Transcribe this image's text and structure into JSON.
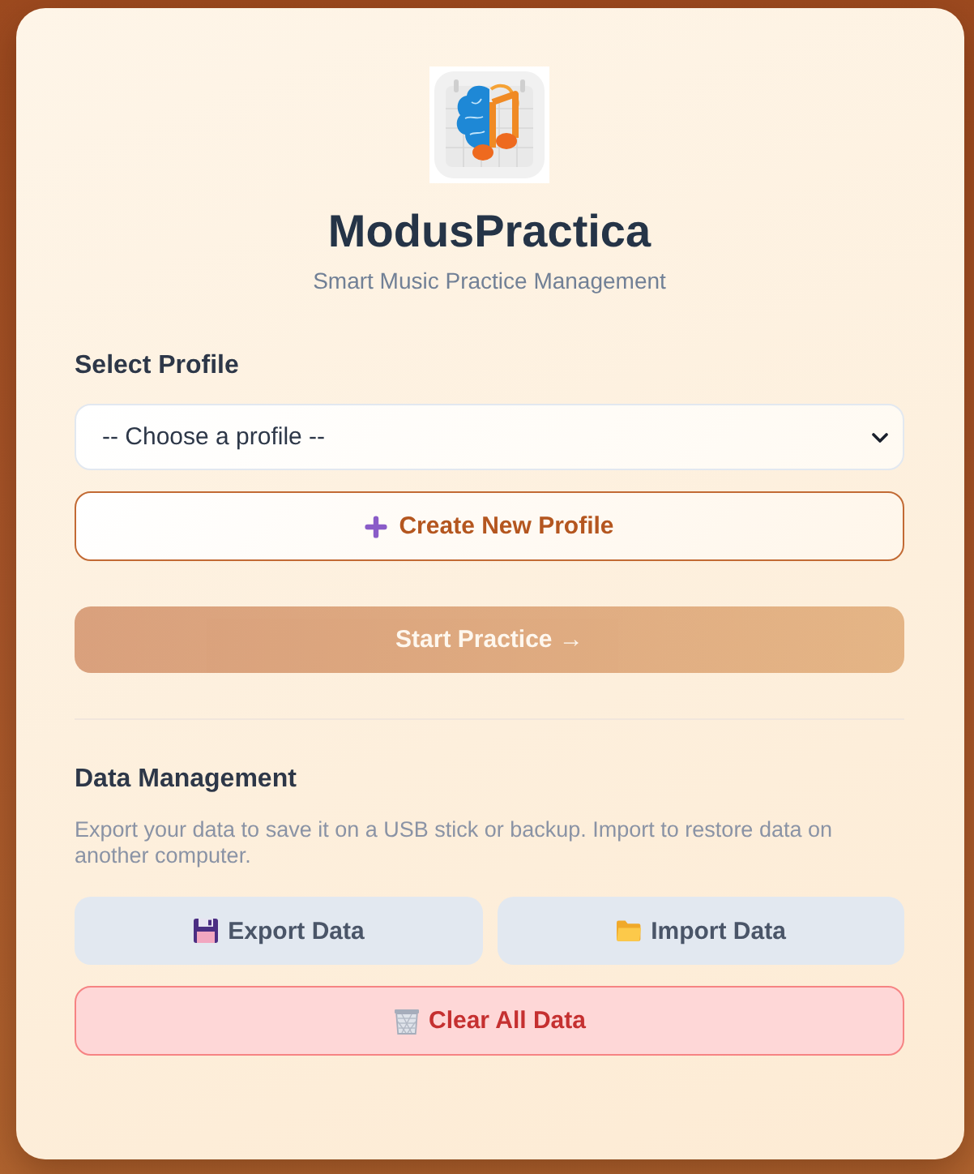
{
  "app": {
    "title": "ModusPractica",
    "subtitle": "Smart Music Practice Management"
  },
  "profile": {
    "label": "Select Profile",
    "select": {
      "value": "-- Choose a profile --"
    },
    "create_button": {
      "label": "Create New Profile"
    },
    "start_button": {
      "label": "Start Practice →",
      "disabled": true
    }
  },
  "data_management": {
    "heading": "Data Management",
    "description": "Export your data to save it on a USB stick or backup. Import to restore data on another computer.",
    "buttons": [
      {
        "kind": "export",
        "label": "Export Data"
      },
      {
        "kind": "import",
        "label": "Import Data"
      },
      {
        "kind": "clear",
        "label": "Clear All Data"
      }
    ]
  }
}
